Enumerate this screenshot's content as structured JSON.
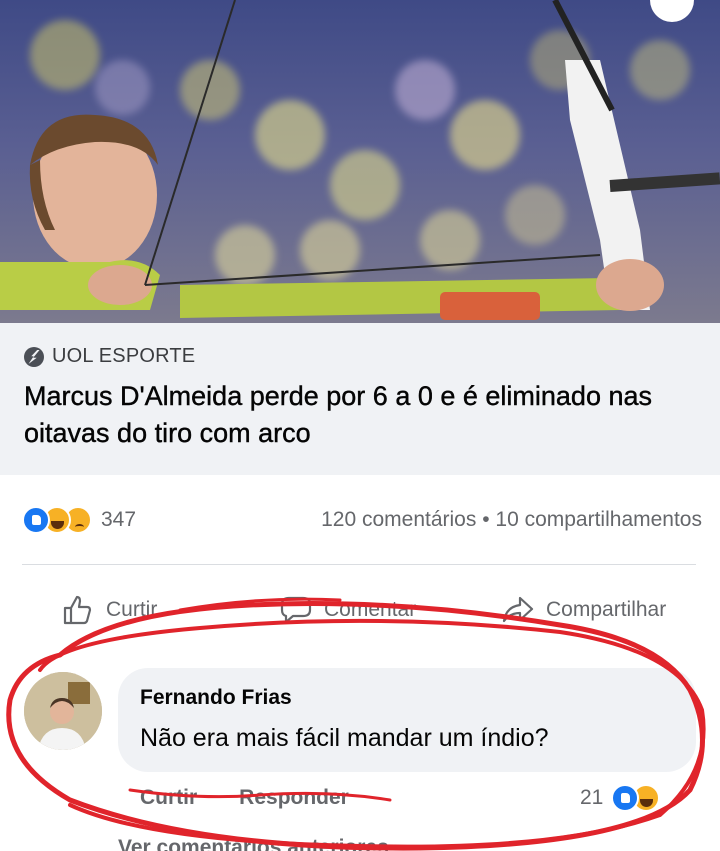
{
  "post": {
    "source": "UOL ESPORTE",
    "headline": "Marcus D'Almeida perde por 6 a 0 e é eliminado nas oitavas do tiro com arco",
    "reaction_count": "347",
    "stats": "120 comentários • 10 compartilhamentos",
    "reaction_icons": [
      "like-icon",
      "haha-icon",
      "sad-icon"
    ]
  },
  "actions": {
    "like_label": "Curtir",
    "comment_label": "Comentar",
    "share_label": "Compartilhar"
  },
  "comment": {
    "author": "Fernando Frias",
    "text": "Não era mais fácil mandar um índio?",
    "like_label": "Curtir",
    "reply_label": "Responder",
    "reaction_count": "21",
    "view_previous": "Ver comentários anteriores"
  },
  "colors": {
    "accent": "#1877f2",
    "annotation_ring": "#e0242b",
    "bubble": "#f0f2f5",
    "secondary_text": "#65676b"
  }
}
